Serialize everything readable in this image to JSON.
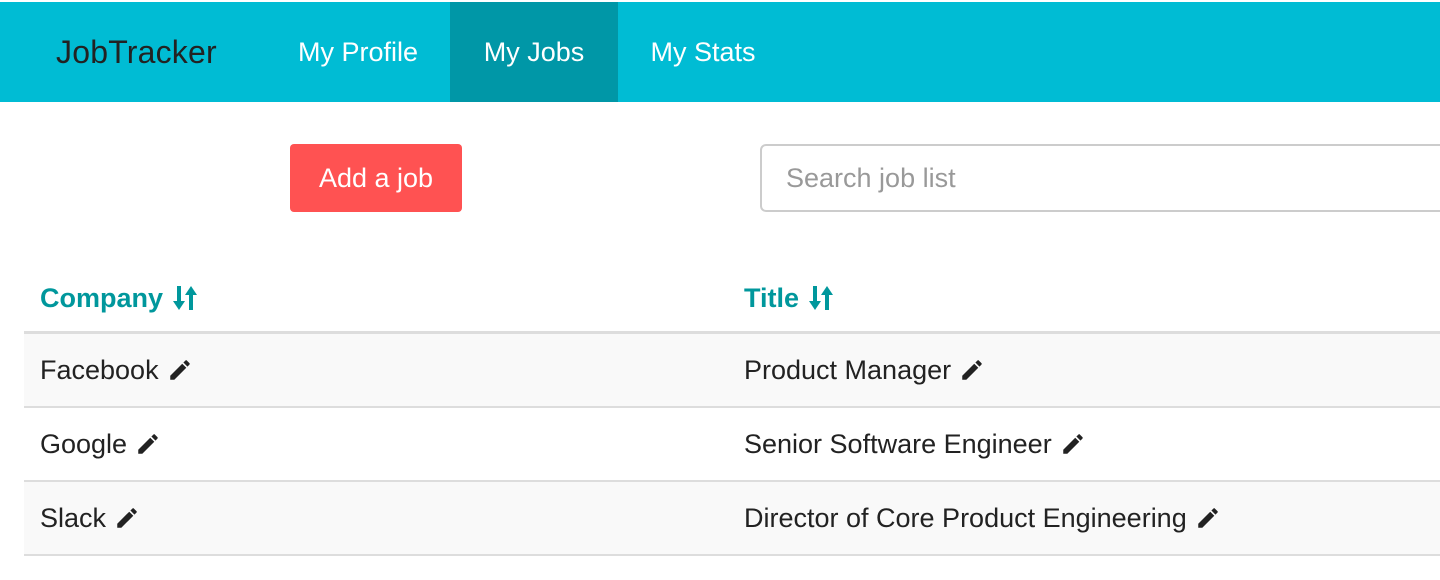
{
  "nav": {
    "brand": "JobTracker",
    "items": [
      {
        "label": "My Profile",
        "active": false
      },
      {
        "label": "My Jobs",
        "active": true
      },
      {
        "label": "My Stats",
        "active": false
      }
    ]
  },
  "toolbar": {
    "add_label": "Add a job",
    "search_placeholder": "Search job list",
    "search_value": ""
  },
  "table": {
    "columns": [
      {
        "label": "Company",
        "icon": "sort-icon"
      },
      {
        "label": "Title",
        "icon": "sort-icon"
      }
    ],
    "rows": [
      {
        "company": "Facebook",
        "title": "Product Manager"
      },
      {
        "company": "Google",
        "title": "Senior Software Engineer"
      },
      {
        "company": "Slack",
        "title": "Director of Core Product Engineering"
      }
    ]
  },
  "colors": {
    "nav_bg": "#00bcd4",
    "nav_active_bg": "#0097a7",
    "add_button": "#ff5252",
    "header_text": "#00979c"
  }
}
